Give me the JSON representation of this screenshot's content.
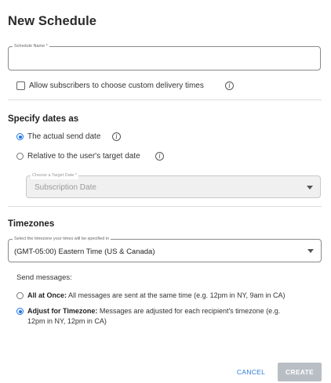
{
  "dialog": {
    "title": "New Schedule"
  },
  "schedule_name": {
    "label": "Schedule Name *",
    "value": ""
  },
  "custom_delivery": {
    "label": "Allow subscribers to choose custom delivery times",
    "checked": false,
    "info_icon": "info-icon"
  },
  "dates": {
    "section_title": "Specify dates as",
    "options": [
      {
        "label": "The actual send date",
        "selected": true
      },
      {
        "label": "Relative to the user's target date",
        "selected": false
      }
    ],
    "target_date": {
      "label": "Choose a Target Date *",
      "value": "Subscription Date",
      "disabled": true
    }
  },
  "timezones": {
    "section_title": "Timezones",
    "select_label": "Select the timezone your times will be specified in",
    "selected_value": "(GMT-05:00) Eastern Time (US & Canada)",
    "send_messages_label": "Send messages:",
    "options": [
      {
        "title": "All at Once:",
        "description": "All messages are sent at the same time (e.g. 12pm in NY, 9am in CA)",
        "selected": false
      },
      {
        "title": "Adjust for Timezone:",
        "description_line1": "Messages are adjusted for each recipient's timezone (e.g.",
        "description_line2": "12pm in NY, 12pm in CA)",
        "selected": true
      }
    ]
  },
  "actions": {
    "cancel_label": "CANCEL",
    "create_label": "CREATE"
  },
  "colors": {
    "accent": "#1a73e8",
    "link": "#2d7bd8",
    "disabled_button": "#b9bec5"
  }
}
